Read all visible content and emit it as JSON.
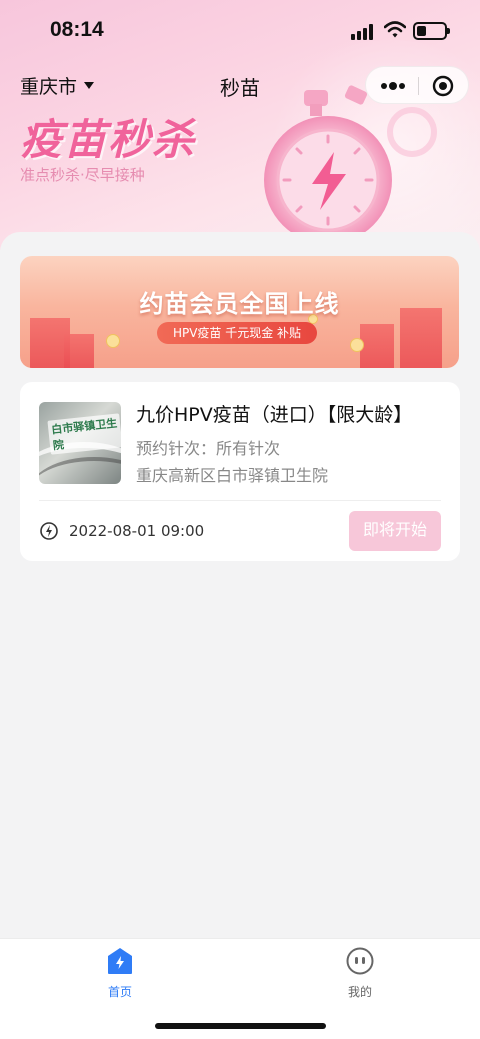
{
  "status_bar": {
    "time": "08:14"
  },
  "nav": {
    "city": "重庆市",
    "title": "秒苗"
  },
  "hero": {
    "title": "疫苗秒杀",
    "subtitle": "准点秒杀·尽早接种"
  },
  "banner": {
    "title": "约苗会员全国上线",
    "pill": "HPV疫苗  千元现金  补贴"
  },
  "card": {
    "thumb_sign": "白市驿镇卫生院",
    "title": "九价HPV疫苗（进口）【限大龄】",
    "dose_line": "预约针次：所有针次",
    "hospital": "重庆高新区白市驿镇卫生院",
    "datetime": "2022-08-01 09:00",
    "button": "即将开始"
  },
  "tabbar": {
    "home_label": "首页",
    "mine_label": "我的"
  },
  "colors": {
    "accent_pink": "#f0639b",
    "button_pink": "#f7c7d9",
    "tab_active": "#2f7cf6",
    "tab_inactive": "#666666"
  },
  "icons": {
    "home": "home-lightning-icon",
    "mine": "robot-face-icon",
    "clock": "clock-lightning-icon",
    "more": "more-dots-icon",
    "target": "target-icon"
  }
}
